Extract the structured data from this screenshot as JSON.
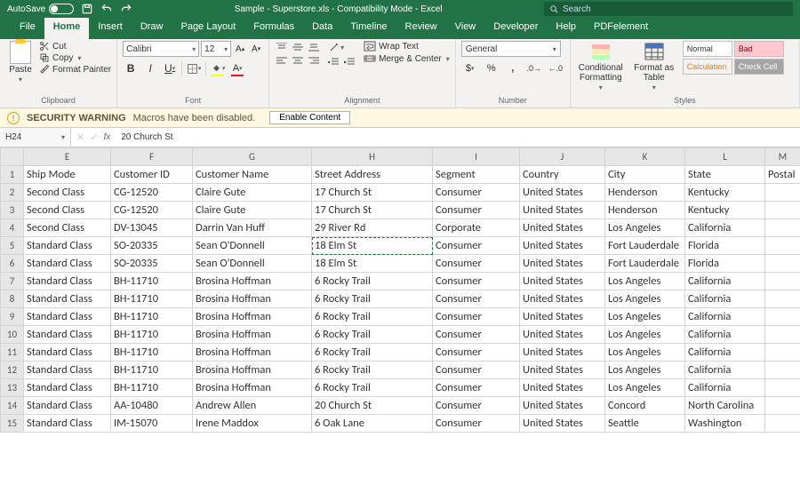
{
  "titlebar": {
    "autosave_label": "AutoSave",
    "autosave_state": "Off",
    "title": "Sample - Superstore.xls  -  Compatibility Mode  -  Excel",
    "search_placeholder": "Search"
  },
  "tabs": [
    "File",
    "Home",
    "Insert",
    "Draw",
    "Page Layout",
    "Formulas",
    "Data",
    "Timeline",
    "Review",
    "View",
    "Developer",
    "Help",
    "PDFelement"
  ],
  "active_tab": "Home",
  "clipboard": {
    "paste": "Paste",
    "cut": "Cut",
    "copy": "Copy",
    "format_painter": "Format Painter",
    "group": "Clipboard"
  },
  "font": {
    "name": "Calibri",
    "size": "12",
    "group": "Font"
  },
  "alignment": {
    "wrap": "Wrap Text",
    "merge": "Merge & Center",
    "group": "Alignment"
  },
  "number": {
    "format": "General",
    "group": "Number"
  },
  "styles": {
    "cond": "Conditional Formatting",
    "table": "Format as Table",
    "normal": "Normal",
    "bad": "Bad",
    "calc": "Calculation",
    "check": "Check Cell",
    "group": "Styles"
  },
  "security": {
    "label": "SECURITY WARNING",
    "msg": "Macros have been disabled.",
    "button": "Enable Content"
  },
  "formula_bar": {
    "cell_ref": "H24",
    "value": "20 Church St"
  },
  "columns": [
    "E",
    "F",
    "G",
    "H",
    "I",
    "J",
    "K",
    "L",
    "M"
  ],
  "headers_row": [
    "Ship Mode",
    "Customer ID",
    "Customer Name",
    "Street Address",
    "Segment",
    "Country",
    "City",
    "State",
    "Postal"
  ],
  "rows": [
    [
      "Second Class",
      "CG-12520",
      "Claire Gute",
      "17 Church St",
      "Consumer",
      "United States",
      "Henderson",
      "Kentucky",
      ""
    ],
    [
      "Second Class",
      "CG-12520",
      "Claire Gute",
      "17 Church St",
      "Consumer",
      "United States",
      "Henderson",
      "Kentucky",
      ""
    ],
    [
      "Second Class",
      "DV-13045",
      "Darrin Van Huff",
      "29 River Rd",
      "Corporate",
      "United States",
      "Los Angeles",
      "California",
      ""
    ],
    [
      "Standard Class",
      "SO-20335",
      "Sean O'Donnell",
      "18 Elm St",
      "Consumer",
      "United States",
      "Fort Lauderdale",
      "Florida",
      ""
    ],
    [
      "Standard Class",
      "SO-20335",
      "Sean O'Donnell",
      "18 Elm St",
      "Consumer",
      "United States",
      "Fort Lauderdale",
      "Florida",
      ""
    ],
    [
      "Standard Class",
      "BH-11710",
      "Brosina Hoffman",
      "6 Rocky Trail",
      "Consumer",
      "United States",
      "Los Angeles",
      "California",
      ""
    ],
    [
      "Standard Class",
      "BH-11710",
      "Brosina Hoffman",
      "6 Rocky Trail",
      "Consumer",
      "United States",
      "Los Angeles",
      "California",
      ""
    ],
    [
      "Standard Class",
      "BH-11710",
      "Brosina Hoffman",
      "6 Rocky Trail",
      "Consumer",
      "United States",
      "Los Angeles",
      "California",
      ""
    ],
    [
      "Standard Class",
      "BH-11710",
      "Brosina Hoffman",
      "6 Rocky Trail",
      "Consumer",
      "United States",
      "Los Angeles",
      "California",
      ""
    ],
    [
      "Standard Class",
      "BH-11710",
      "Brosina Hoffman",
      "6 Rocky Trail",
      "Consumer",
      "United States",
      "Los Angeles",
      "California",
      ""
    ],
    [
      "Standard Class",
      "BH-11710",
      "Brosina Hoffman",
      "6 Rocky Trail",
      "Consumer",
      "United States",
      "Los Angeles",
      "California",
      ""
    ],
    [
      "Standard Class",
      "BH-11710",
      "Brosina Hoffman",
      "6 Rocky Trail",
      "Consumer",
      "United States",
      "Los Angeles",
      "California",
      ""
    ],
    [
      "Standard Class",
      "AA-10480",
      "Andrew Allen",
      "20 Church St",
      "Consumer",
      "United States",
      "Concord",
      "North Carolina",
      ""
    ],
    [
      "Standard Class",
      "IM-15070",
      "Irene Maddox",
      "6 Oak Lane",
      "Consumer",
      "United States",
      "Seattle",
      "Washington",
      ""
    ]
  ],
  "marching_cell": {
    "row": 5,
    "col": "H"
  }
}
